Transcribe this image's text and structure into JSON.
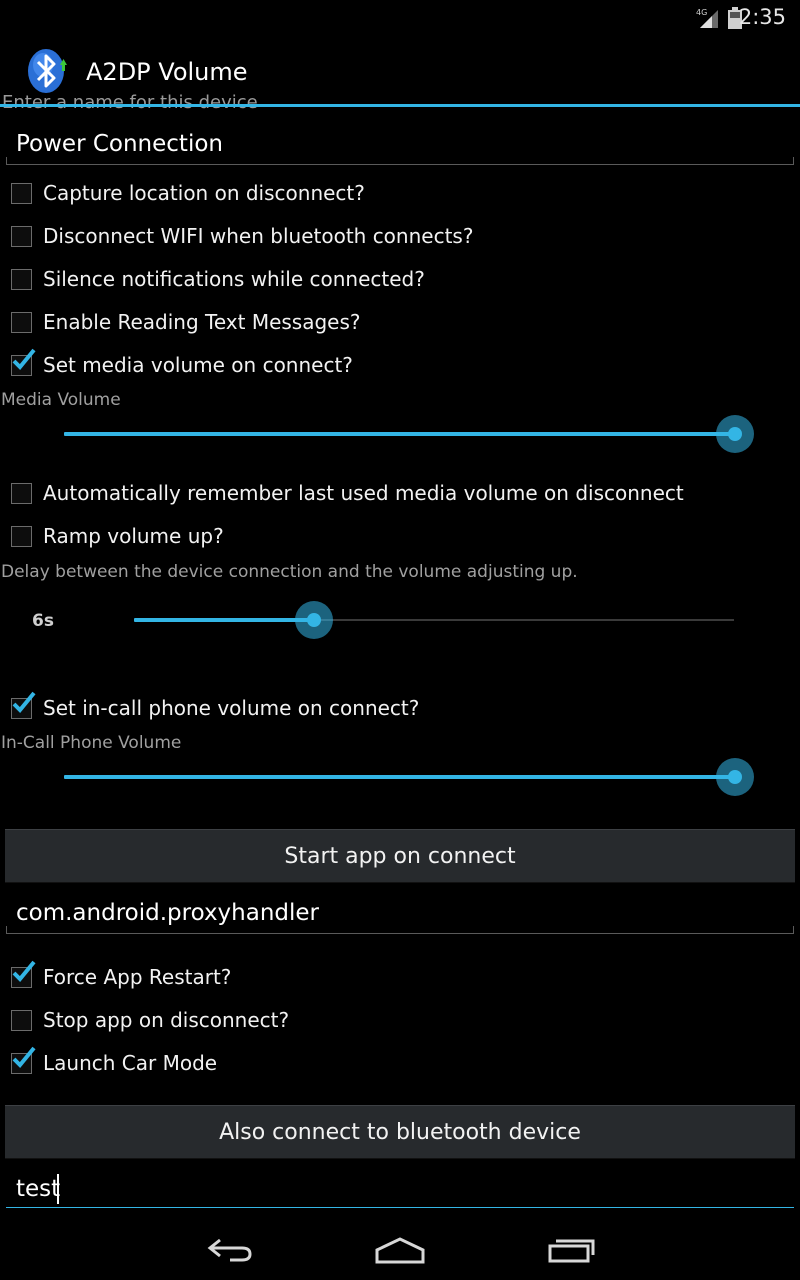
{
  "status_bar": {
    "time": "2:35",
    "network": "4G"
  },
  "action_bar": {
    "title": "A2DP Volume"
  },
  "device_name": {
    "label": "Enter a name for this device",
    "value": "Power Connection"
  },
  "checkboxes_top": [
    {
      "label": "Capture location on disconnect?",
      "checked": false
    },
    {
      "label": "Disconnect WIFI when bluetooth connects?",
      "checked": false
    },
    {
      "label": "Silence notifications while connected?",
      "checked": false
    },
    {
      "label": "Enable Reading Text Messages?",
      "checked": false
    },
    {
      "label": "Set media volume on connect?",
      "checked": true
    }
  ],
  "media_volume": {
    "label": "Media Volume",
    "level": 1.0
  },
  "checkboxes_mid": [
    {
      "label": "Automatically remember last used media volume on disconnect",
      "checked": false
    },
    {
      "label": "Ramp volume up?",
      "checked": false
    }
  ],
  "ramp_delay": {
    "label": "Delay between the device connection and the volume adjusting up.",
    "value": "6s",
    "level": 0.3
  },
  "incall": {
    "checkbox_label": "Set in-call phone volume on connect?",
    "checked": true,
    "label": "In-Call Phone Volume",
    "level": 1.0
  },
  "start_app_button": "Start app on connect",
  "app_package": "com.android.proxyhandler",
  "checkboxes_app": [
    {
      "label": "Force App Restart?",
      "checked": true
    },
    {
      "label": "Stop app on disconnect?",
      "checked": false
    },
    {
      "label": "Launch Car Mode",
      "checked": true
    }
  ],
  "also_connect_button": "Also connect to bluetooth device",
  "bt_device_field": {
    "value": "test"
  },
  "colors": {
    "accent": "#33b5e5",
    "background": "#000000"
  }
}
